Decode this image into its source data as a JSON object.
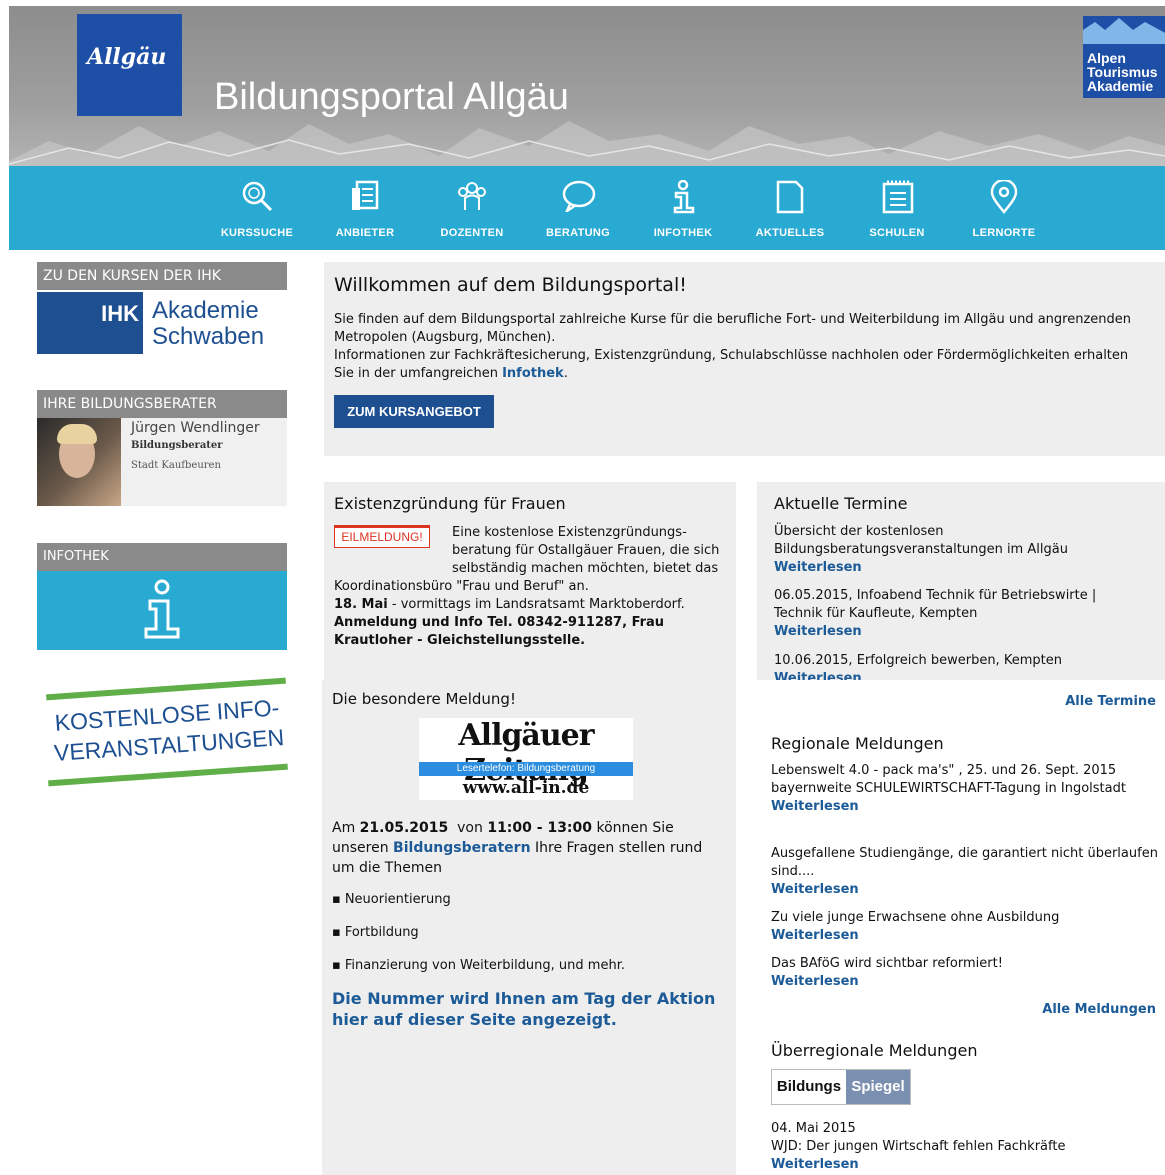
{
  "header": {
    "logo_left": "Allgäu",
    "title": "Bildungsportal Allgäu",
    "logo_right": "Alpen\nTourismus\nAkademie"
  },
  "nav": [
    {
      "label": "KURSSUCHE",
      "icon": "search-icon"
    },
    {
      "label": "ANBIETER",
      "icon": "document-icon"
    },
    {
      "label": "DOZENTEN",
      "icon": "people-icon"
    },
    {
      "label": "BERATUNG",
      "icon": "speech-bubble-icon"
    },
    {
      "label": "INFOTHEK",
      "icon": "info-icon"
    },
    {
      "label": "AKTUELLES",
      "icon": "page-icon"
    },
    {
      "label": "SCHULEN",
      "icon": "notepad-icon"
    },
    {
      "label": "LERNORTE",
      "icon": "map-pin-icon"
    }
  ],
  "sidebar": {
    "ihk": {
      "heading": "ZU DEN KURSEN DER IHK",
      "logo_ihk": "IHK",
      "logo_line1": "Akademie",
      "logo_line2": "Schwaben"
    },
    "berater": {
      "heading": "IHRE BILDUNGSBERATER",
      "name": "Jürgen Wendlinger",
      "role": "Bildungsberater",
      "location": "Stadt Kaufbeuren"
    },
    "infothek": {
      "heading": "INFOTHEK"
    },
    "promo": {
      "line1": "KOSTENLOSE INFO-",
      "line2": "VERANSTALTUNGEN"
    }
  },
  "welcome": {
    "title": "Willkommen auf dem Bildungsportal!",
    "text1": "Sie finden auf dem Bildungsportal zahlreiche Kurse für die berufliche Fort- und Weiterbildung im Allgäu und angrenzenden Metropolen (Augsburg, München).",
    "text2": "Informationen zur Fachkräftesicherung, Existenzgründung, Schulabschlüsse nachholen oder Fördermöglichkeiten erhalten Sie in der umfangreichen",
    "link": "Infothek",
    "button": "ZUM KURSANGEBOT"
  },
  "existenz": {
    "title": "Existenzgründung für Frauen",
    "badge": "EILMELDUNG!",
    "text": "Eine kostenlose Existenzgründungs-beratung für Ostallgäuer Frauen, die sich selbständig machen möchten, bietet das Koordinationsbüro \"Frau und Beruf\" an.",
    "date_bold": "18. Mai",
    "date_rest": " - vormittags im Landsratsamt Marktoberdorf.",
    "contact": "Anmeldung und Info Tel. 08342-911287, Frau Krautloher - Gleichstellungsstelle."
  },
  "termine": {
    "title": "Aktuelle Termine",
    "items": [
      {
        "text": "Übersicht der kostenlosen Bildungsberatungsveranstaltungen im Allgäu",
        "link": "Weiterlesen"
      },
      {
        "text": "06.05.2015, Infoabend Technik für Betriebswirte | Technik für Kaufleute, Kempten",
        "link": "Weiterlesen"
      },
      {
        "text": "10.06.2015, Erfolgreich bewerben, Kempten",
        "link": "Weiterlesen"
      }
    ],
    "all_link": "Alle Termine"
  },
  "meldung": {
    "title": "Die besondere Meldung!",
    "az_name": "Allgäuer Zeitung",
    "az_bar": "Lesertelefon: Bildungsberatung",
    "az_web": "www.all-in.de",
    "t1": "Am ",
    "date": "21.05.2015",
    "t2": "  von ",
    "time": "11:00 - 13:00",
    "t3": " können Sie unseren ",
    "link": "Bildungsberatern",
    "t4": " Ihre Fragen stellen rund um die Themen",
    "bullets": [
      "Neuorientierung",
      "Fortbildung",
      "Finanzierung von Weiterbildung, und mehr."
    ],
    "highlight": "Die Nummer wird Ihnen am Tag der Aktion hier auf dieser Seite angezeigt."
  },
  "regional": {
    "title": "Regionale Meldungen",
    "items": [
      {
        "text": "Lebenswelt 4.0 - pack ma's\" , 25. und 26. Sept. 2015 bayernweite SCHULEWIRTSCHAFT-Tagung in Ingolstadt",
        "link": "Weiterlesen"
      },
      {
        "text": "Ausgefallene Studiengänge, die garantiert nicht überlaufen sind....",
        "link": "Weiterlesen"
      },
      {
        "text": "Zu viele junge Erwachsene ohne Ausbildung",
        "link": "Weiterlesen"
      },
      {
        "text": "Das BAföG wird sichtbar reformiert!",
        "link": "Weiterlesen"
      }
    ],
    "all_link": "Alle Meldungen"
  },
  "ueberregional": {
    "title": "Überregionale Meldungen",
    "logo_left": "Bildungs",
    "logo_right": "Spiegel",
    "date": "04. Mai 2015",
    "text": "WJD: Der jungen Wirtschaft fehlen Fachkräfte",
    "link": "Weiterlesen"
  }
}
